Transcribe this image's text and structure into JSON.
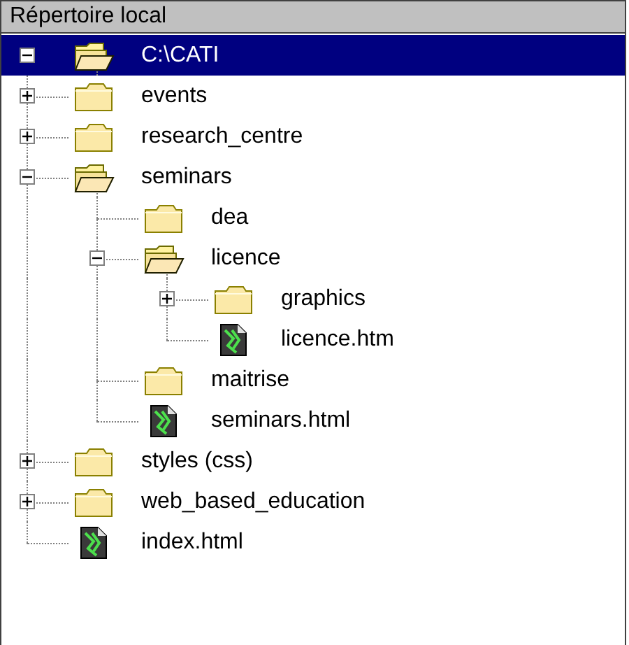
{
  "panel": {
    "title": "Répertoire local"
  },
  "tree": [
    {
      "name": "C:\\CATI",
      "kind": "folder",
      "expanded": true,
      "selected": true,
      "children": [
        {
          "name": "events",
          "kind": "folder",
          "expanded": false,
          "selected": false
        },
        {
          "name": "research_centre",
          "kind": "folder",
          "expanded": false,
          "selected": false
        },
        {
          "name": "seminars",
          "kind": "folder",
          "expanded": true,
          "selected": false,
          "children": [
            {
              "name": "dea",
              "kind": "folder",
              "selected": false
            },
            {
              "name": "licence",
              "kind": "folder",
              "expanded": true,
              "selected": false,
              "children": [
                {
                  "name": "graphics",
                  "kind": "folder",
                  "expanded": false,
                  "selected": false
                },
                {
                  "name": "licence.htm",
                  "kind": "file",
                  "selected": false
                }
              ]
            },
            {
              "name": "maitrise",
              "kind": "folder",
              "selected": false
            },
            {
              "name": "seminars.html",
              "kind": "file",
              "selected": false
            }
          ]
        },
        {
          "name": "styles (css)",
          "kind": "folder",
          "expanded": false,
          "selected": false
        },
        {
          "name": "web_based_education",
          "kind": "folder",
          "expanded": false,
          "selected": false
        },
        {
          "name": "index.html",
          "kind": "file",
          "selected": false
        }
      ]
    }
  ]
}
